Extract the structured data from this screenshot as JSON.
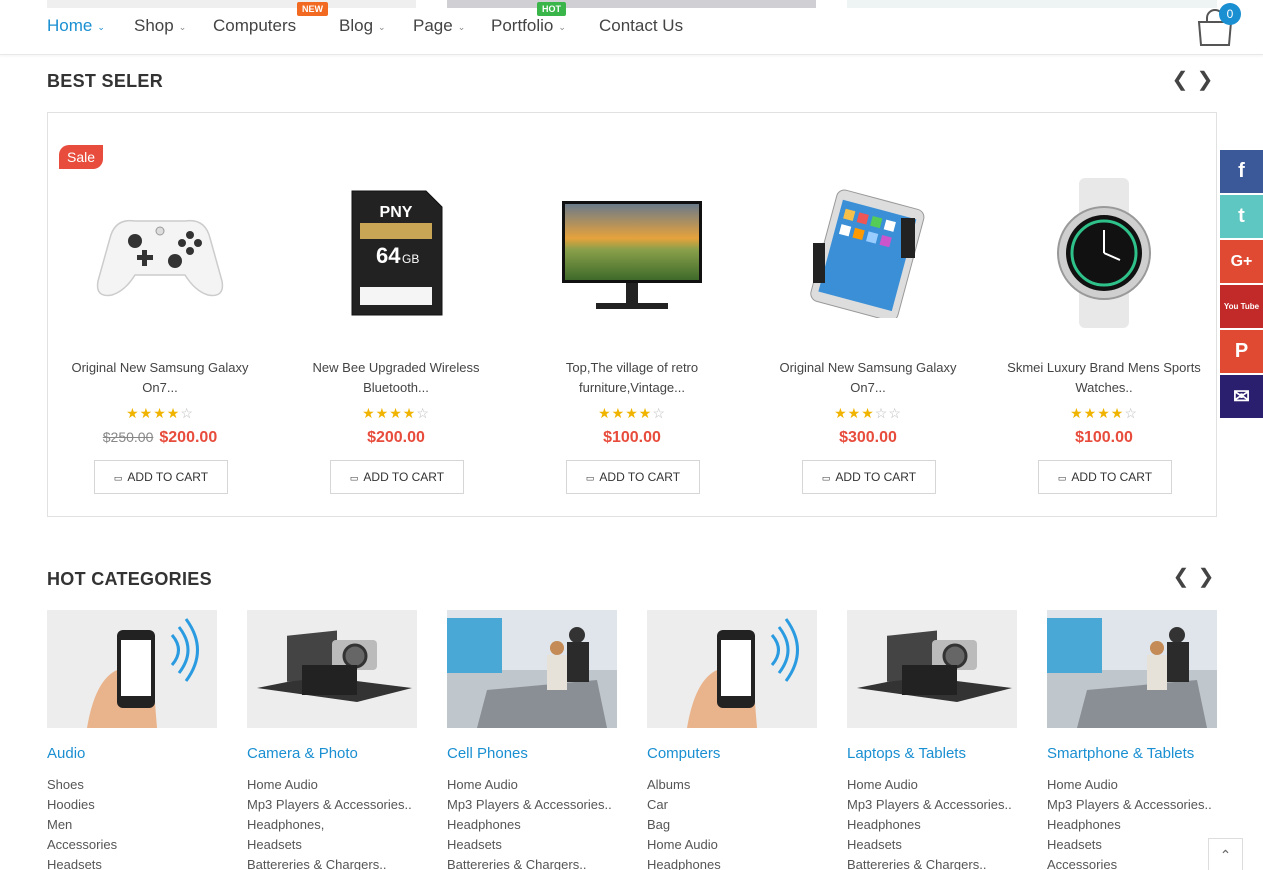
{
  "nav": {
    "items": [
      {
        "label": "Home",
        "caret": "⌄"
      },
      {
        "label": "Shop",
        "caret": "⌄"
      },
      {
        "label": "Computers",
        "badge": "NEW"
      },
      {
        "label": "Blog",
        "caret": "⌄"
      },
      {
        "label": "Page",
        "caret": "⌄"
      },
      {
        "label": "Portfolio",
        "caret": "⌄",
        "badge": "HOT"
      },
      {
        "label": "Contact Us"
      }
    ],
    "cart_count": "0"
  },
  "best_seller": {
    "title": "BEST SELER",
    "prev": "❮",
    "next": "❯",
    "products": [
      {
        "sale": "Sale",
        "name1": "Original New Samsung Galaxy",
        "name2": "On7...",
        "stars": "★★★★",
        "stars_off": "☆",
        "old_price": "$250.00",
        "price": "$200.00",
        "cart": "ADD TO CART",
        "cart_icon": "🛒"
      },
      {
        "name1": "New Bee Upgraded Wireless",
        "name2": "Bluetooth...",
        "stars": "★★★★",
        "stars_off": "☆",
        "price": "$200.00",
        "cart": "ADD TO CART"
      },
      {
        "name1": "Top,The village of retro",
        "name2": "furniture,Vintage...",
        "stars": "★★★★",
        "stars_off": "☆",
        "price": "$100.00",
        "cart": "ADD TO CART"
      },
      {
        "name1": "Original New Samsung Galaxy",
        "name2": "On7...",
        "stars": "★★★",
        "stars_off": "☆☆",
        "price": "$300.00",
        "cart": "ADD TO CART"
      },
      {
        "name1": "Skmei Luxury Brand Mens Sports",
        "name2": "Watches..",
        "stars": "★★★★",
        "stars_off": "☆",
        "price": "$100.00",
        "cart": "ADD TO CART"
      }
    ],
    "sd_label": "PNY",
    "sd_size": "64",
    "sd_unit": "GB"
  },
  "social": {
    "facebook": "f",
    "twitter": "t",
    "google": "G+",
    "youtube": "You Tube",
    "pinterest": "P",
    "email": "✉"
  },
  "hot_categories": {
    "title": "HOT CATEGORIES",
    "prev": "❮",
    "next": "❯",
    "items": [
      {
        "title": "Audio",
        "links": [
          "Shoes",
          "Hoodies",
          "Men",
          "Accessories",
          "Headsets"
        ]
      },
      {
        "title": "Camera & Photo",
        "links": [
          "Home Audio",
          "Mp3 Players & Accessories..",
          "Headphones,",
          "Headsets",
          "Battereries & Chargers.."
        ]
      },
      {
        "title": "Cell Phones",
        "links": [
          "Home Audio",
          "Mp3 Players & Accessories..",
          "Headphones",
          "Headsets",
          "Battereries & Chargers.."
        ]
      },
      {
        "title": "Computers",
        "links": [
          "Albums",
          "Car",
          "Bag",
          "Home Audio",
          "Headphones"
        ]
      },
      {
        "title": "Laptops & Tablets",
        "links": [
          "Home Audio",
          "Mp3 Players & Accessories..",
          "Headphones",
          "Headsets",
          "Battereries & Chargers.."
        ]
      },
      {
        "title": "Smartphone & Tablets",
        "links": [
          "Home Audio",
          "Mp3 Players & Accessories..",
          "Headphones",
          "Headsets",
          "Accessories"
        ]
      }
    ]
  },
  "back_to_top": "⌃",
  "colors": {
    "accent": "#1a8fd1",
    "price": "#e74c3c",
    "star": "#f0b400",
    "new_badge": "#f26a21",
    "hot_badge": "#3ab54a"
  }
}
